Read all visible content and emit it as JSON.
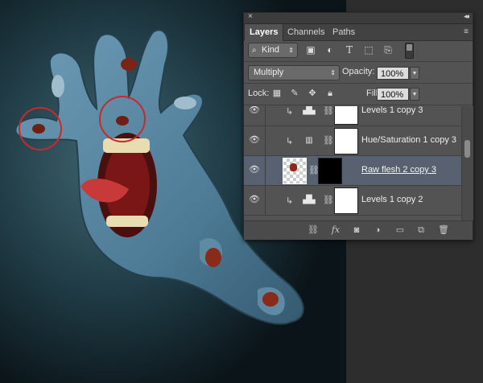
{
  "panel": {
    "close_glyph": "×",
    "collapse_glyph": "◂◂",
    "tabs": [
      {
        "label": "Layers",
        "active": true
      },
      {
        "label": "Channels",
        "active": false
      },
      {
        "label": "Paths",
        "active": false
      }
    ],
    "menu_glyph": "≡"
  },
  "filter": {
    "kind_label": "Kind",
    "icons": [
      "image-filter-icon",
      "adjustment-filter-icon",
      "type-filter-icon",
      "shape-filter-icon",
      "smart-object-filter-icon"
    ]
  },
  "blend": {
    "mode": "Multiply",
    "opacity_label": "Opacity:",
    "opacity_value": "100%"
  },
  "lock": {
    "label": "Lock:",
    "fill_label": "Fill:",
    "fill_value": "100%"
  },
  "layers": [
    {
      "name": "Levels 1 copy 3",
      "type": "adjustment",
      "selected": false
    },
    {
      "name": "Hue/Saturation 1 copy 3",
      "type": "adjustment",
      "selected": false
    },
    {
      "name": "Raw flesh 2 copy 3",
      "type": "pixel",
      "selected": true
    },
    {
      "name": "Levels 1 copy 2",
      "type": "adjustment",
      "selected": false
    }
  ],
  "bottom_icons": [
    "link-layers-icon",
    "fx-icon",
    "add-mask-icon",
    "new-adjustment-icon",
    "new-group-icon",
    "new-layer-icon",
    "trash-icon"
  ],
  "colors": {
    "panel_bg": "#535353",
    "selected_row": "#57616f",
    "annotation_circle": "#c62a2a"
  }
}
